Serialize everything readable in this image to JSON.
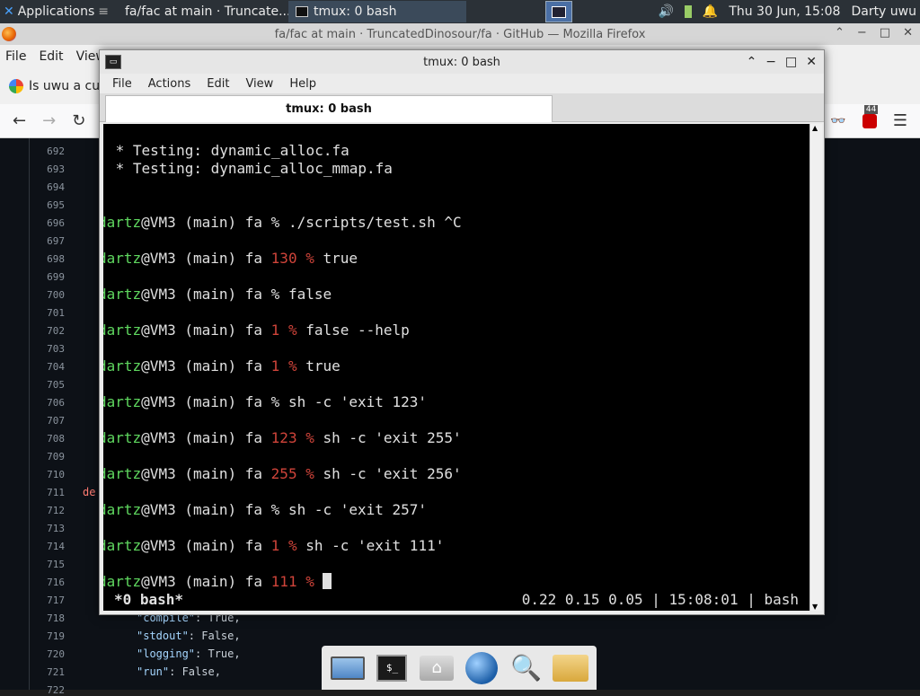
{
  "top_panel": {
    "apps_label": "Applications",
    "tasks": [
      {
        "label": "fa/fac at main · Truncate..."
      },
      {
        "label": "tmux: 0 bash"
      }
    ],
    "datetime": "Thu 30 Jun, 15:08",
    "user": "Darty uwu"
  },
  "firefox": {
    "title": "fa/fac at main · TruncatedDinosour/fa · GitHub — Mozilla Firefox",
    "menu": [
      "File",
      "Edit",
      "View"
    ],
    "tab_label": "Is uwu a cu",
    "badge_count": "44",
    "line_numbers": [
      "692",
      "693",
      "694",
      "695",
      "696",
      "697",
      "698",
      "699",
      "700",
      "701",
      "702",
      "703",
      "704",
      "705",
      "706",
      "707",
      "708",
      "709",
      "710",
      "711",
      "712",
      "713",
      "714",
      "715",
      "716",
      "717",
      "718",
      "719",
      "720",
      "721",
      "722"
    ],
    "code_lines": [
      {
        "num": "711",
        "text": "de"
      },
      {
        "num": "718",
        "key": "\"compile\"",
        "rest": ": True,"
      },
      {
        "num": "719",
        "key": "\"stdout\"",
        "rest": ": False,"
      },
      {
        "num": "720",
        "key": "\"logging\"",
        "rest": ": True,"
      },
      {
        "num": "721",
        "key": "\"run\"",
        "rest": ": False,"
      }
    ]
  },
  "tmux_window": {
    "title": "tmux: 0 bash",
    "menu": [
      "File",
      "Actions",
      "Edit",
      "View",
      "Help"
    ],
    "tab_label": "tmux: 0 bash",
    "terminal_lines": [
      {
        "plain": " * Testing: dynamic_alloc.fa"
      },
      {
        "plain": " * Testing: dynamic_alloc_mmap.fa"
      },
      {
        "user": "dartz",
        "host": "@VM3 (main) fa ",
        "code": "",
        "cmd": "% ./scripts/test.sh ^C"
      },
      {
        "user": "dartz",
        "host": "@VM3 (main) fa ",
        "code": "130 %",
        "cmd": " true"
      },
      {
        "user": "dartz",
        "host": "@VM3 (main) fa ",
        "code": "",
        "cmd": "% false"
      },
      {
        "user": "dartz",
        "host": "@VM3 (main) fa ",
        "code": "1 %",
        "cmd": " false --help"
      },
      {
        "user": "dartz",
        "host": "@VM3 (main) fa ",
        "code": "1 %",
        "cmd": " true"
      },
      {
        "user": "dartz",
        "host": "@VM3 (main) fa ",
        "code": "",
        "cmd": "% sh -c 'exit 123'"
      },
      {
        "user": "dartz",
        "host": "@VM3 (main) fa ",
        "code": "123 %",
        "cmd": " sh -c 'exit 255'"
      },
      {
        "user": "dartz",
        "host": "@VM3 (main) fa ",
        "code": "255 %",
        "cmd": " sh -c 'exit 256'"
      },
      {
        "user": "dartz",
        "host": "@VM3 (main) fa ",
        "code": "",
        "cmd": "% sh -c 'exit 257'"
      },
      {
        "user": "dartz",
        "host": "@VM3 (main) fa ",
        "code": "1 %",
        "cmd": " sh -c 'exit 111'"
      },
      {
        "user": "dartz",
        "host": "@VM3 (main) fa ",
        "code": "111 %",
        "cmd": " "
      }
    ],
    "status_left": "*0 bash*",
    "status_right": "0.22 0.15 0.05 | 15:08:01 | bash"
  },
  "dock": {
    "items": [
      "display-icon",
      "terminal-icon",
      "home-folder-icon",
      "web-browser-icon",
      "search-icon",
      "folder-icon"
    ]
  },
  "colors": {
    "prompt_user": "#5fd75f",
    "exit_code": "#d0443a"
  }
}
